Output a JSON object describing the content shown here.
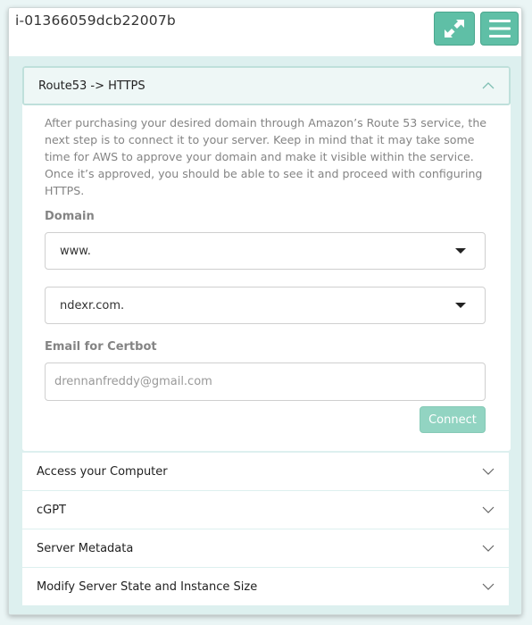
{
  "header": {
    "instance_id": "i-01366059dcb22007b",
    "expand_icon": "expand-icon",
    "menu_icon": "hamburger-menu-icon"
  },
  "open_section": {
    "title": "Route53 -> HTTPS",
    "description": "After purchasing your desired domain through Amazon’s Route 53 service, the next step is to connect it to your server. Keep in mind that it may take some time for AWS to approve your domain and make it visible within the service. Once it’s approved, you should be able to see it and proceed with configuring HTTPS.",
    "domain_label": "Domain",
    "subdomain_value": "www.",
    "domain_value": "ndexr.com.",
    "email_label": "Email for Certbot",
    "email_placeholder": "drennanfreddy@gmail.com",
    "connect_label": "Connect"
  },
  "sections": [
    {
      "title": "Access your Computer"
    },
    {
      "title": "cGPT"
    },
    {
      "title": "Server Metadata"
    },
    {
      "title": "Modify Server State and Instance Size"
    }
  ],
  "colors": {
    "accent": "#5fbfa6",
    "background": "#ddf0ef",
    "button_disabled": "#92d4c2"
  }
}
